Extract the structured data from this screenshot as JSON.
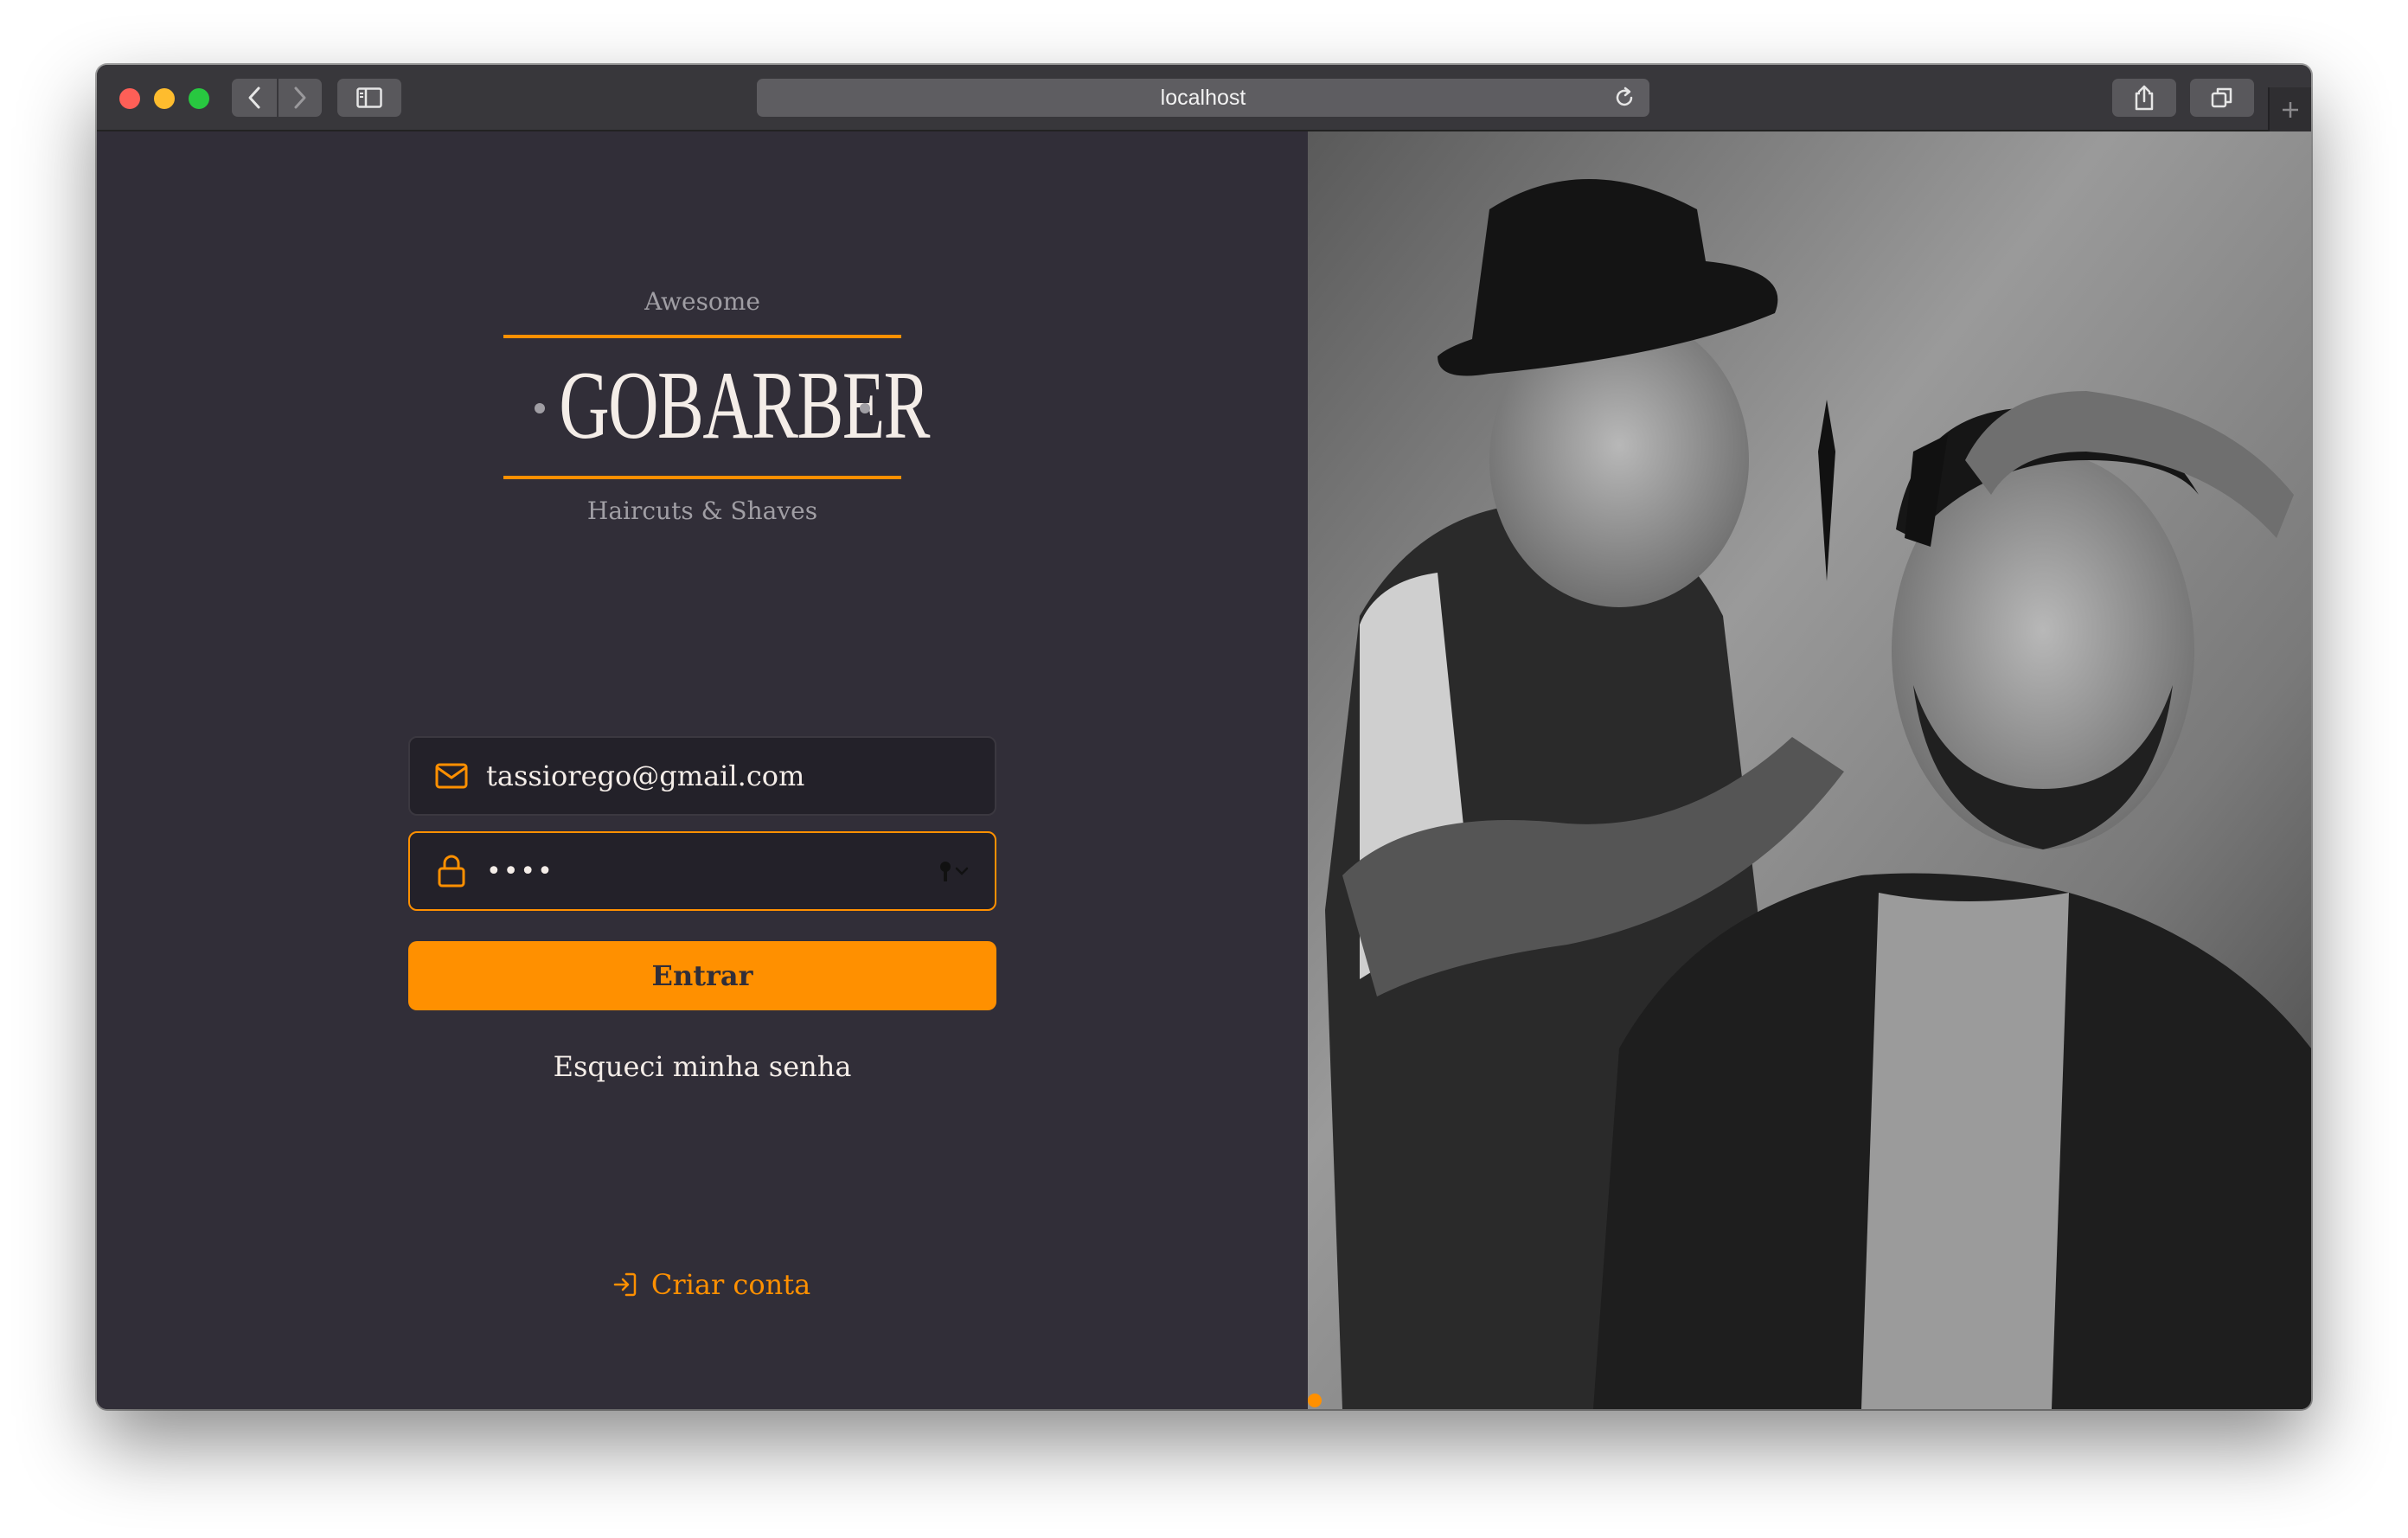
{
  "browser": {
    "url": "localhost",
    "icons": {
      "back": "chevron-left-icon",
      "forward": "chevron-right-icon",
      "sidebar": "sidebar-icon",
      "reload": "reload-icon",
      "share": "share-icon",
      "tabs": "tabs-overview-icon",
      "new_tab": "plus-icon"
    }
  },
  "logo": {
    "tagline_top": "Awesome",
    "name": "GOBARBER",
    "tagline_bottom": "Haircuts & Shaves"
  },
  "form": {
    "email_value": "tassiorego@gmail.com",
    "email_icon": "mail-icon",
    "password_mask": "••••",
    "password_icon": "lock-icon",
    "password_manager_icon": "key-icon",
    "submit_label": "Entrar",
    "forgot_label": "Esqueci minha senha"
  },
  "signup": {
    "label": "Criar conta",
    "icon": "log-in-icon"
  },
  "colors": {
    "background": "#312e38",
    "input_background": "#232129",
    "accent": "#ff9000",
    "text": "#f4ede8",
    "muted": "#a09ea4"
  },
  "hero_image": "black-and-white photo of a barber cutting a bearded man's hair"
}
